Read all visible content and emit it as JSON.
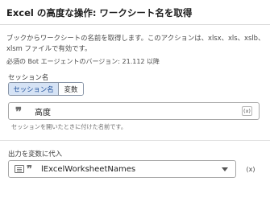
{
  "header": {
    "title": "Excel の高度な操作: ワークシート名を取得"
  },
  "description": {
    "text": "ブックからワークシートの名前を取得します。このアクションは、xlsx、xls、xslb、xlsm ファイルで有効です。",
    "version": "必須の Bot エージェントのバージョン: 21.112 以降"
  },
  "session": {
    "label": "セッション名",
    "toggle": {
      "options": [
        "セッション名",
        "変数"
      ],
      "selected": "セッション名"
    },
    "value": "高度",
    "value_icon": "quote-icon",
    "variable_badge": "(x)",
    "hint": "セッションを開いたときに付けた名前です。"
  },
  "output": {
    "label": "出力を変数に代入",
    "value": "lExcelWorksheetNames",
    "type_icons": [
      "list-icon",
      "quote-icon"
    ],
    "insert_variable": "(x)"
  },
  "colors": {
    "active_toggle_bg": "#d6e3f5",
    "active_toggle_text": "#1e4f9a",
    "border": "#a7a7a7"
  }
}
